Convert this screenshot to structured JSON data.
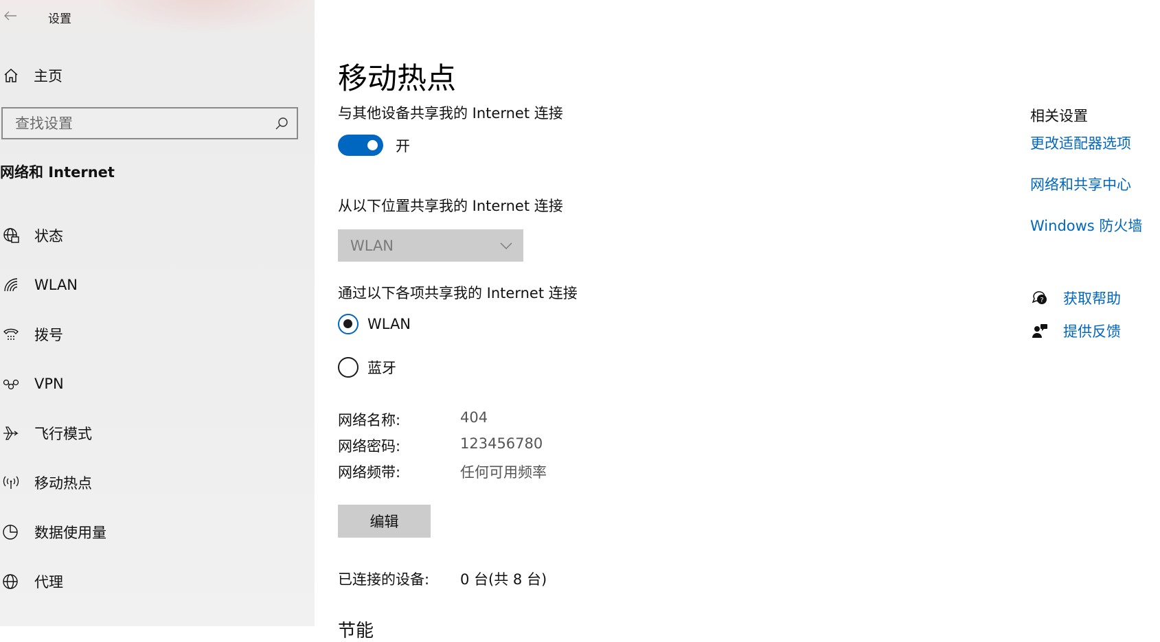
{
  "window": {
    "title": "设置"
  },
  "sidebar": {
    "home_label": "主页",
    "search": {
      "placeholder": "查找设置"
    },
    "section_header": "网络和 Internet",
    "items": [
      {
        "label": "状态",
        "icon": "globe-status-icon"
      },
      {
        "label": "WLAN",
        "icon": "wifi-icon"
      },
      {
        "label": "拨号",
        "icon": "dialup-icon"
      },
      {
        "label": "VPN",
        "icon": "vpn-icon"
      },
      {
        "label": "飞行模式",
        "icon": "airplane-icon"
      },
      {
        "label": "移动热点",
        "icon": "hotspot-icon"
      },
      {
        "label": "数据使用量",
        "icon": "data-usage-icon"
      },
      {
        "label": "代理",
        "icon": "globe-icon"
      }
    ]
  },
  "main": {
    "title": "移动热点",
    "share_label": "与其他设备共享我的 Internet 连接",
    "toggle_state": "开",
    "toggle_on": true,
    "share_from_label": "从以下位置共享我的 Internet 连接",
    "share_from_value": "WLAN",
    "share_over_label": "通过以下各项共享我的 Internet 连接",
    "share_over_options": [
      {
        "label": "WLAN",
        "selected": true
      },
      {
        "label": "蓝牙",
        "selected": false
      }
    ],
    "network_info": [
      {
        "key": "网络名称:",
        "value": "404"
      },
      {
        "key": "网络密码:",
        "value": "123456780"
      },
      {
        "key": "网络频带:",
        "value": "任何可用频率"
      }
    ],
    "edit_label": "编辑",
    "connected_key": "已连接的设备:",
    "connected_value": "0 台(共 8 台)",
    "next_heading": "节能"
  },
  "related": {
    "title": "相关设置",
    "links": [
      "更改适配器选项",
      "网络和共享中心",
      "Windows 防火墙"
    ],
    "help_label": "获取帮助",
    "feedback_label": "提供反馈"
  },
  "colors": {
    "accent": "#0067c0",
    "sidebar_bg": "#eeeeee",
    "button_bg": "#cccccc"
  }
}
